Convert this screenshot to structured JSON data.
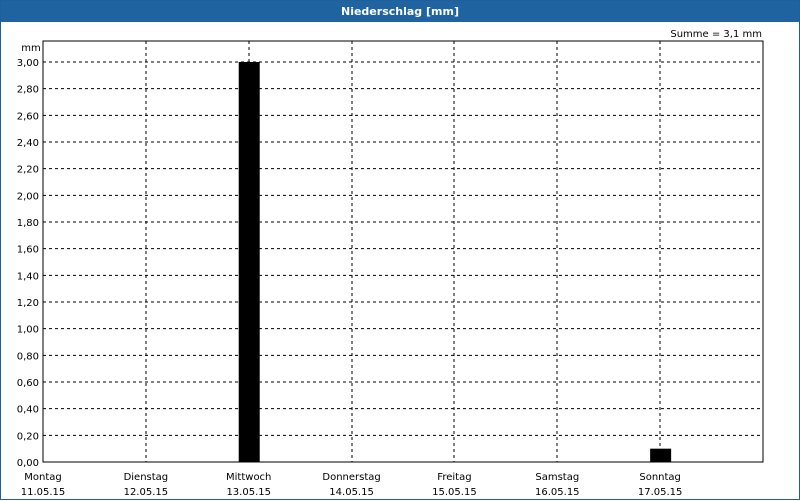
{
  "window": {
    "title": "Niederschlag [mm]"
  },
  "summary": "Summe = 3,1 mm",
  "chart_data": {
    "type": "bar",
    "title": "Niederschlag [mm]",
    "ylabel": "mm",
    "xlabel": "",
    "ylim": [
      0,
      3.1
    ],
    "yticks": [
      0,
      0.2,
      0.4,
      0.6,
      0.8,
      1.0,
      1.2,
      1.4,
      1.6,
      1.8,
      2.0,
      2.2,
      2.4,
      2.6,
      2.8,
      3.0
    ],
    "ytick_labels": [
      "0,00",
      "0,20",
      "0,40",
      "0,60",
      "0,80",
      "1,00",
      "1,20",
      "1,40",
      "1,60",
      "1,80",
      "2,00",
      "2,20",
      "2,40",
      "2,60",
      "2,80",
      "3,00"
    ],
    "categories": [
      {
        "day": "Montag",
        "date": "11.05.15"
      },
      {
        "day": "Dienstag",
        "date": "12.05.15"
      },
      {
        "day": "Mittwoch",
        "date": "13.05.15"
      },
      {
        "day": "Donnerstag",
        "date": "14.05.15"
      },
      {
        "day": "Freitag",
        "date": "15.05.15"
      },
      {
        "day": "Samstag",
        "date": "16.05.15"
      },
      {
        "day": "Sonntag",
        "date": "17.05.15"
      }
    ],
    "values": [
      0.0,
      0.0,
      3.0,
      0.0,
      0.0,
      0.0,
      0.1
    ],
    "grid": true,
    "bar_color": "#000000"
  }
}
